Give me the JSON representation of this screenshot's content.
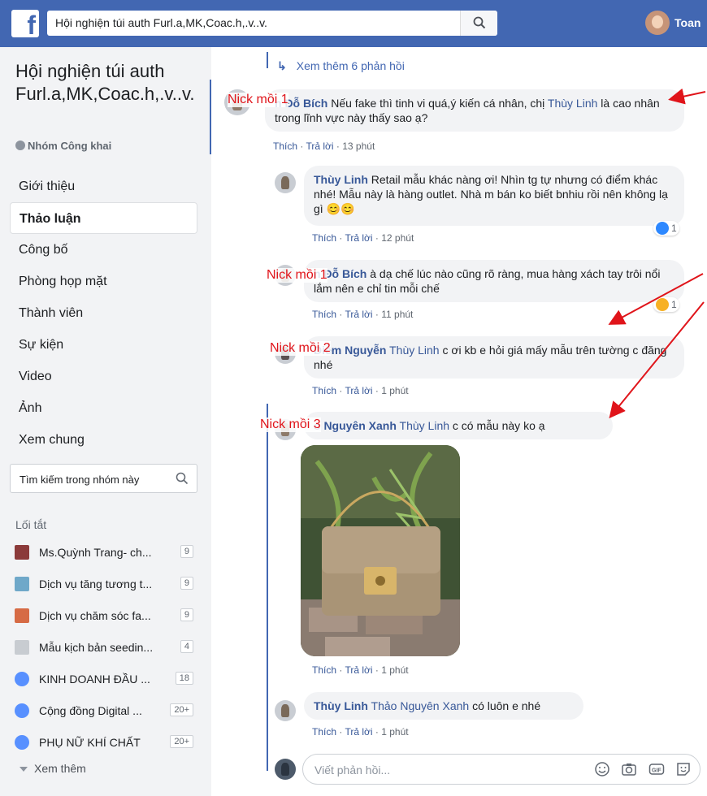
{
  "topbar": {
    "logo": "f",
    "search_value": "Hội nghiện túi auth Furl.a,MK,Coac.h,.v..v.",
    "user_name": "Toan"
  },
  "sidebar": {
    "group_title": "Hội nghiện túi auth Furl.a,MK,Coac.h,.v..v.",
    "group_type": "Nhóm Công khai",
    "nav": [
      {
        "label": "Giới thiệu"
      },
      {
        "label": "Thảo luận"
      },
      {
        "label": "Công bố"
      },
      {
        "label": "Phòng họp mặt"
      },
      {
        "label": "Thành viên"
      },
      {
        "label": "Sự kiện"
      },
      {
        "label": "Video"
      },
      {
        "label": "Ảnh"
      },
      {
        "label": "Xem chung"
      }
    ],
    "search_placeholder": "Tìm kiếm trong nhóm này",
    "shortcuts_title": "Lối tắt",
    "shortcuts": [
      {
        "label": "Ms.Quỳnh Trang- ch...",
        "count": "9"
      },
      {
        "label": "Dịch vụ tăng tương t...",
        "count": "9"
      },
      {
        "label": "Dịch vụ chăm sóc fa...",
        "count": "9"
      },
      {
        "label": "Mẫu kịch bản seedin...",
        "count": "4"
      },
      {
        "label": "KINH DOANH ĐẦU ...",
        "count": "18"
      },
      {
        "label": "Cộng đồng Digital ...",
        "count": "20+"
      },
      {
        "label": "PHỤ NỮ KHÍ CHẤT",
        "count": "20+"
      }
    ],
    "see_more": "Xem thêm"
  },
  "thread": {
    "view_more_replies": "Xem thêm 6 phản hồi",
    "like": "Thích",
    "reply": "Trả lời",
    "comments": [
      {
        "author": "n Đỗ Bích",
        "mention": "Thùy Linh",
        "text_before": "Nếu fake thì tinh vi quá,ý kiến cá nhân, chị",
        "text_after": "là cao nhân trong lĩnh vực này thấy sao ạ?",
        "time": "13 phút",
        "tag": "Nick mồi 1"
      },
      {
        "author": "Thùy Linh",
        "text": "Retail mẫu khác nàng ơi! Nhìn tg tự nhưng có điểm khác nhé! Mẫu này là hàng outlet. Nhà m bán ko biết bnhiu rồi nên không lạ gì 😊😊",
        "time": "12 phút",
        "reaction_count": "1"
      },
      {
        "author": "n Đỗ Bích",
        "text": "à dạ chế lúc nào cũng rõ ràng, mua hàng xách tay trôi nổi lắm nên e chỉ tin mỗi chế",
        "time": "11 phút",
        "tag": "Nick mồi 1",
        "reaction_count": "1"
      },
      {
        "author": "Diễm Nguyễn",
        "mention": "Thùy Linh",
        "text": "c ơi kb e hỏi giá mấy mẫu trên tường c đăng nhé",
        "time": "1 phút",
        "tag": "Nick mồi 2"
      },
      {
        "author": "o Nguyên Xanh",
        "mention": "Thùy Linh",
        "text": "c có mẫu này ko ạ",
        "time": "1 phút",
        "tag": "Nick mồi 3"
      },
      {
        "author": "Thùy Linh",
        "mention": "Thảo Nguyên Xanh",
        "text": "có luôn e nhé",
        "time": "1 phút"
      }
    ],
    "reply_placeholder": "Viết phản hồi..."
  },
  "colors": {
    "brand": "#4267b2",
    "link": "#385898",
    "annotation": "#e0141a"
  },
  "icons": [
    "facebook-logo-icon",
    "search-icon",
    "globe-icon",
    "chevron-down-icon",
    "smile-icon",
    "camera-icon",
    "gif-icon",
    "sticker-icon",
    "like-reaction-icon",
    "haha-reaction-icon"
  ]
}
